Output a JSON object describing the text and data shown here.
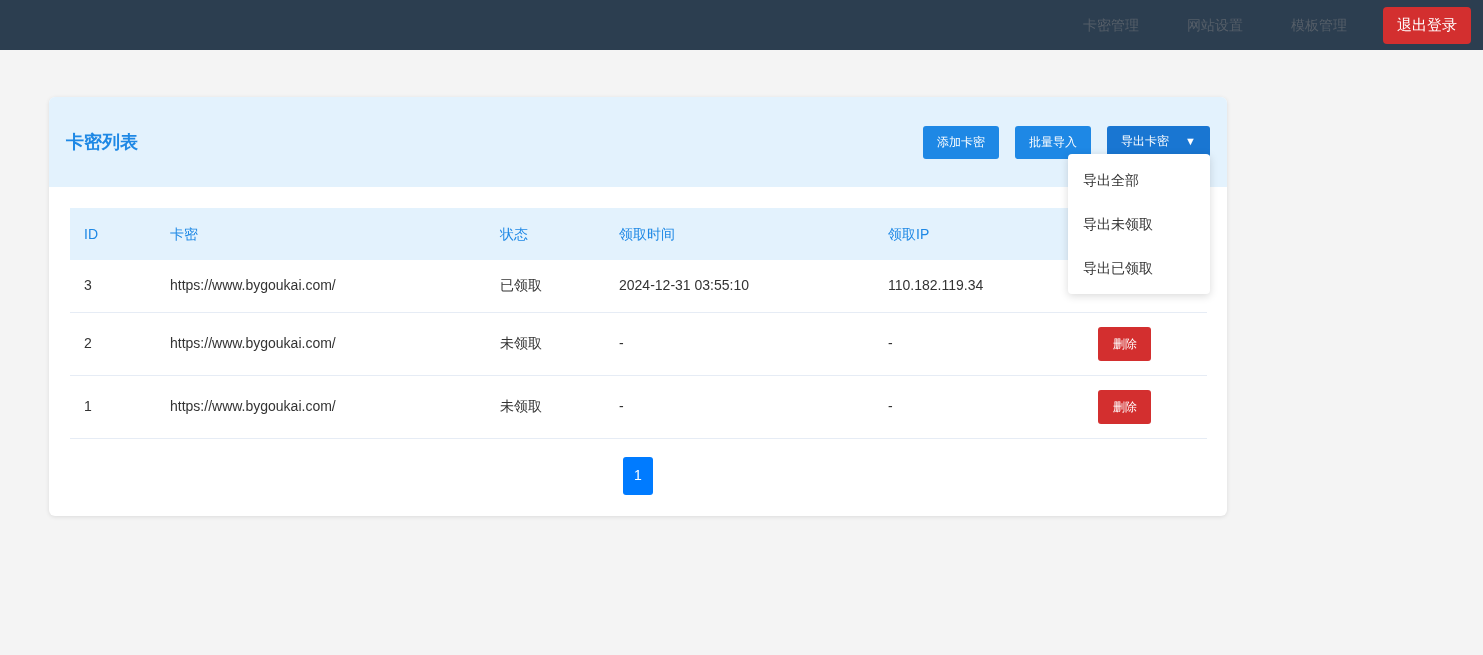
{
  "nav": {
    "links": [
      "卡密管理",
      "网站设置",
      "模板管理"
    ],
    "logout": "退出登录"
  },
  "card": {
    "title": "卡密列表",
    "buttons": [
      "添加卡密",
      "批量导入"
    ],
    "export": {
      "label": "导出卡密",
      "caret": "▼",
      "expanded": true,
      "items": [
        "导出全部",
        "导出未领取",
        "导出已领取"
      ]
    }
  },
  "table": {
    "columns": [
      "ID",
      "卡密",
      "状态",
      "领取时间",
      "领取IP"
    ],
    "rows": [
      {
        "cells": [
          "3",
          "https://www.bygoukai.com/",
          "已领取",
          "2024-12-31 03:55:10",
          "110.182.119.34"
        ]
      },
      {
        "cells": [
          "2",
          "https://www.bygoukai.com/",
          "未领取",
          "-",
          "-"
        ],
        "action": "删除"
      },
      {
        "cells": [
          "1",
          "https://www.bygoukai.com/",
          "未领取",
          "-",
          "-"
        ],
        "action": "删除"
      }
    ]
  },
  "pagination": [
    {
      "label": "1",
      "selected": true
    }
  ]
}
